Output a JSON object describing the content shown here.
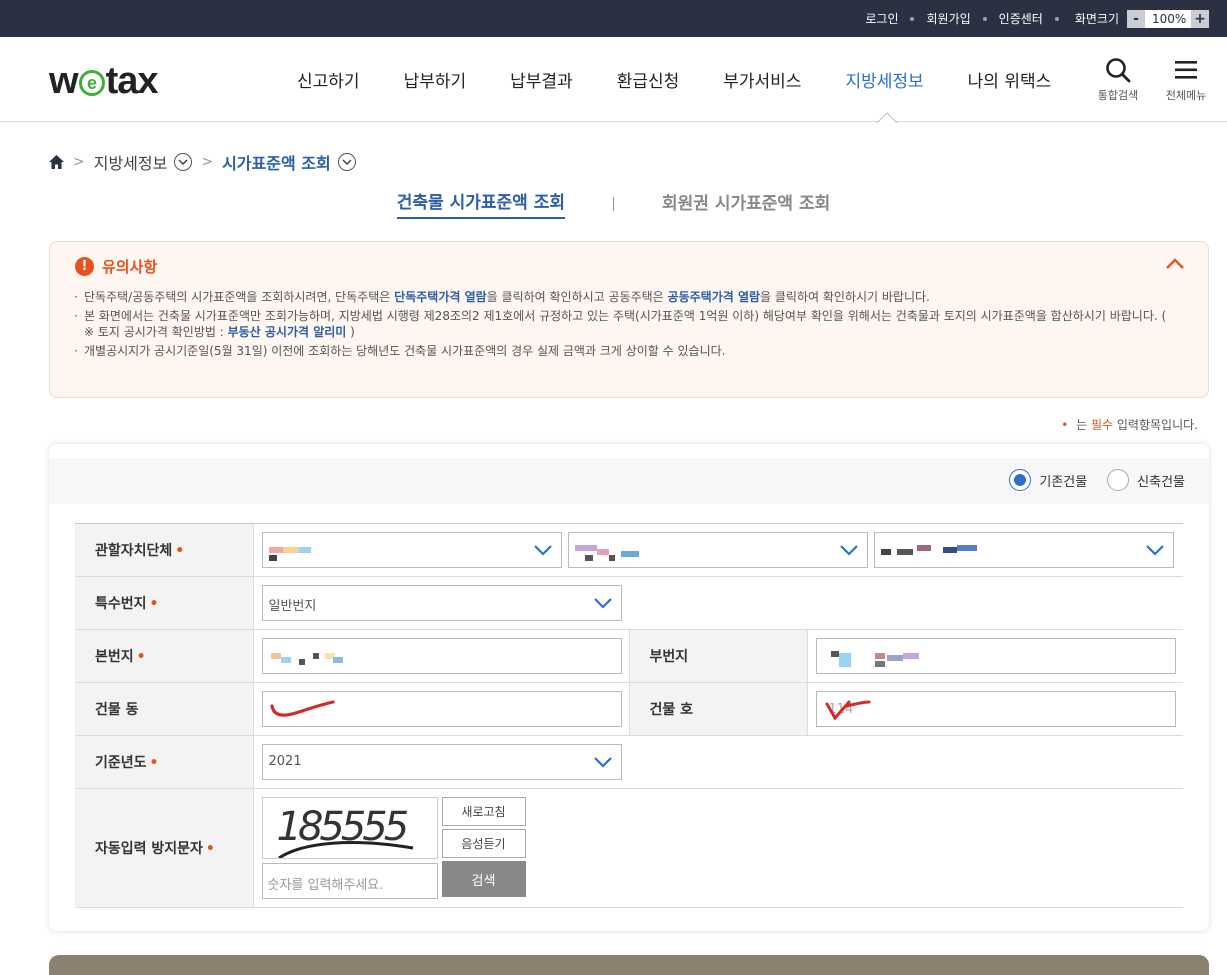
{
  "topbar": {
    "login": "로그인",
    "signup": "회원가입",
    "cert_center": "인증센터",
    "zoom_label": "화면크기",
    "zoom_minus": "-",
    "zoom_value": "100%",
    "zoom_plus": "+"
  },
  "header": {
    "logo_pre": "w",
    "logo_e": "e",
    "logo_post": "tax",
    "nav": [
      {
        "label": "신고하기"
      },
      {
        "label": "납부하기"
      },
      {
        "label": "납부결과"
      },
      {
        "label": "환급신청"
      },
      {
        "label": "부가서비스"
      },
      {
        "label": "지방세정보"
      },
      {
        "label": "나의 위택스"
      }
    ],
    "search_label": "통합검색",
    "menu_label": "전체메뉴"
  },
  "breadcrumb": {
    "level1": "지방세정보",
    "level2": "시가표준액 조회"
  },
  "subtabs": {
    "tab1": "건축물 시가표준액 조회",
    "tab2": "회원권 시가표준액 조회"
  },
  "notice": {
    "title": "유의사항",
    "l1_a": "단독주택/공동주택의 시가표준액을 조회하시려면, 단독주택은 ",
    "l1_link1": "단독주택가격 열람",
    "l1_b": "을 클릭하여 확인하시고 공동주택은 ",
    "l1_link2": "공동주택가격 열람",
    "l1_c": "을 클릭하여 확인하시기 바랍니다.",
    "l2_a": "본 화면에서는 건축물 시가표준액만 조회가능하며, 지방세법 시행령 제28조의2 제1호에서 규정하고 있는 주택(시가표준액 1억원 이하) 해당여부 확인을 위해서는 건축물과 토지의 시가표준액을 합산하시기 바랍니다. ( ※ 토지 공시가격 확인방법 : ",
    "l2_link": "부동산 공시가격 알리미",
    "l2_b": " )",
    "l3": "개별공시지가 공시기준일(5월 31일) 이전에 조회하는 당해년도 건축물 시가표준액의 경우 실제 금액과 크게 상이할 수 있습니다."
  },
  "required_note": {
    "star": "•",
    "a": " 는 ",
    "req": "필수",
    "b": " 입력항목입니다."
  },
  "form": {
    "radio_existing": "기존건물",
    "radio_new": "신축건물",
    "label_region": "관할자치단체",
    "label_special": "특수번지",
    "special_value": "일반번지",
    "label_main_no": "본번지",
    "label_sub_no": "부번지",
    "label_bldg_dong": "건물 동",
    "label_bldg_ho": "건물 호",
    "bldg_ho_value": "114",
    "label_year": "기준년도",
    "year_value": "2021",
    "label_captcha": "자동입력 방지문자",
    "captcha_text": "185555",
    "refresh_btn": "새로고침",
    "audio_btn": "음성듣기",
    "captcha_placeholder": "숫자를 입력해주세요.",
    "search_btn": "검색",
    "req_star": "•"
  },
  "colors": {
    "topbar_bg": "#2b3142",
    "accent_blue": "#2c6fd1",
    "accent_orange": "#e5531f",
    "notice_bg": "#fdf6f1",
    "logo_green": "#3fb13a"
  }
}
